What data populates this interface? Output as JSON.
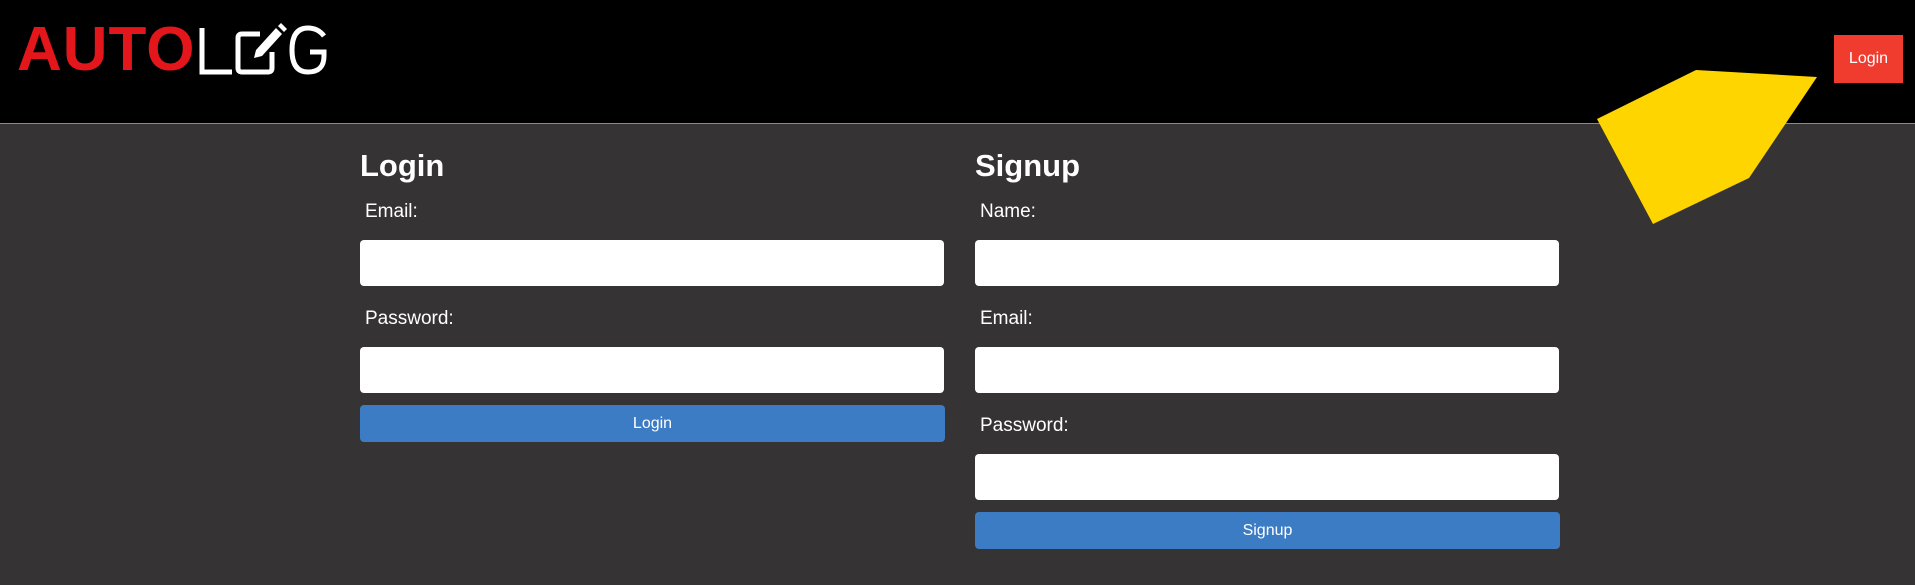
{
  "header": {
    "logo_auto": "AUTO",
    "logo_log": "LOG",
    "login_button_label": "Login"
  },
  "login_form": {
    "title": "Login",
    "email_label": "Email:",
    "email_value": "",
    "password_label": "Password:",
    "password_value": "",
    "submit_label": "Login"
  },
  "signup_form": {
    "title": "Signup",
    "name_label": "Name:",
    "name_value": "",
    "email_label": "Email:",
    "email_value": "",
    "password_label": "Password:",
    "password_value": "",
    "submit_label": "Signup"
  },
  "colors": {
    "header_bg": "#000000",
    "page_bg": "#353334",
    "brand_red": "#e3161b",
    "nav_button": "#f03b2f",
    "primary_button": "#3b7cc4",
    "annotation_arrow": "#ffd500"
  }
}
